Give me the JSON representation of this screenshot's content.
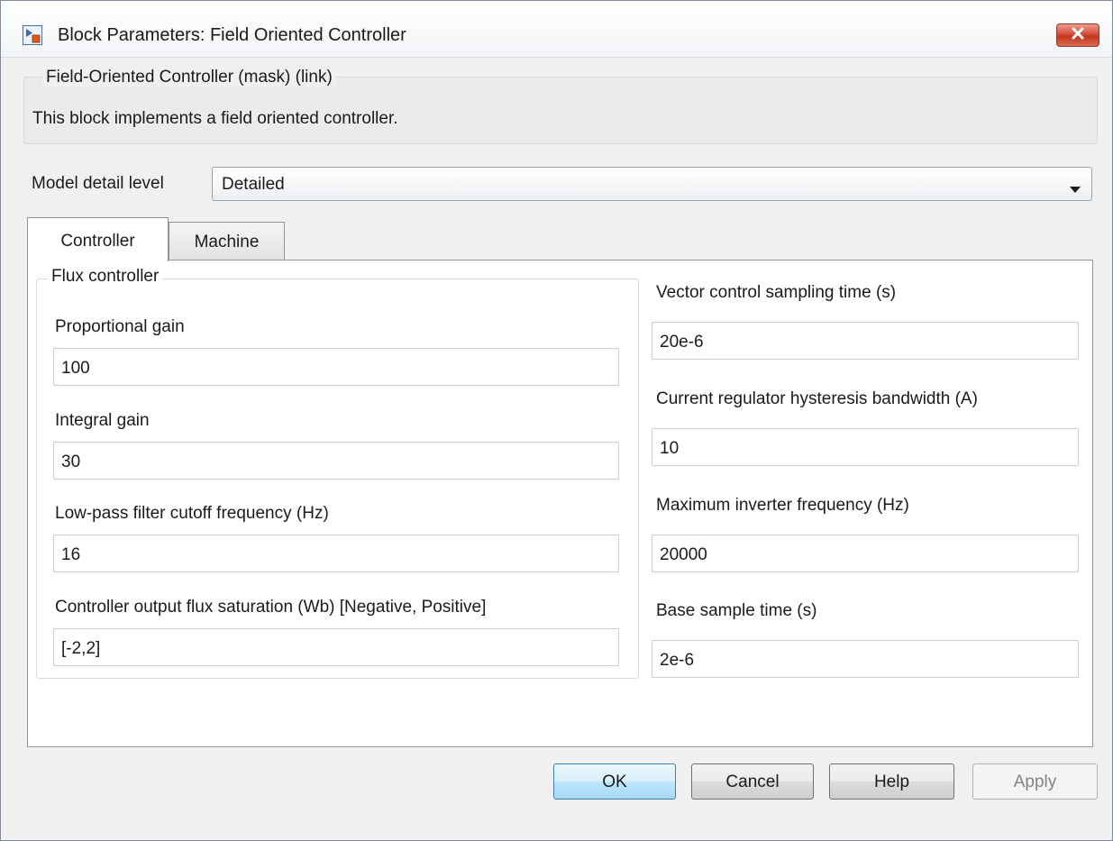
{
  "window": {
    "title": "Block Parameters: Field Oriented Controller",
    "close_icon": "close-x-icon"
  },
  "mask": {
    "heading": "Field-Oriented Controller (mask) (link)",
    "description": "This block implements a field oriented controller."
  },
  "model_detail": {
    "label": "Model detail level",
    "value": "Detailed"
  },
  "tabs": [
    {
      "label": "Controller",
      "active": true
    },
    {
      "label": "Machine",
      "active": false
    }
  ],
  "flux_controller": {
    "heading": "Flux controller",
    "fields": [
      {
        "label": "Proportional gain",
        "value": "100"
      },
      {
        "label": "Integral gain",
        "value": "30"
      },
      {
        "label": "Low-pass filter cutoff frequency (Hz)",
        "value": "16"
      },
      {
        "label": "Controller output flux saturation (Wb) [Negative, Positive]",
        "value": "[-2,2]"
      }
    ]
  },
  "right_fields": [
    {
      "label": "Vector control sampling time (s)",
      "value": "20e-6"
    },
    {
      "label": "Current regulator hysteresis bandwidth (A)",
      "value": "10"
    },
    {
      "label": "Maximum inverter frequency (Hz)",
      "value": "20000"
    },
    {
      "label": "Base sample time (s)",
      "value": "2e-6"
    }
  ],
  "buttons": {
    "ok": "OK",
    "cancel": "Cancel",
    "help": "Help",
    "apply": "Apply"
  }
}
